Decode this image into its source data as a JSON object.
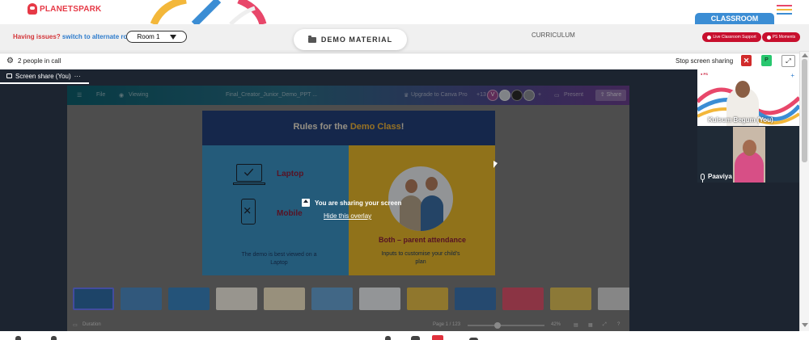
{
  "header": {
    "logo_text": "PLANETSPARK",
    "classroom_tab": "CLASSROOM"
  },
  "toolbar": {
    "issue_text": "Having issues?",
    "issue_link": "switch to alternate room",
    "room_value": "Room 1",
    "demo_material": "DEMO MATERIAL",
    "curriculum": "CURRICULUM",
    "live_classroom_support": "Live Classroom Support",
    "ps_moments": "PS Moments"
  },
  "call": {
    "people_count": "2 people in call",
    "stop_sharing": "Stop screen sharing",
    "stop_x": "✕",
    "self_avatar": "P"
  },
  "stage": {
    "tab_label": "Screen share (You)",
    "tab_menu": "···",
    "overlay_message": "You are sharing your screen",
    "hide_overlay": "Hide this overlay"
  },
  "shared_screen": {
    "menu_file": "File",
    "menu_viewing": "Viewing",
    "doc_name": "Final_Creator_Junior_Demo_PPT ...",
    "upgrade": "Upgrade to Canva Pro",
    "collab_count": "+13",
    "collab_initial": "V",
    "present": "Present",
    "share": "Share",
    "slide": {
      "title_prefix": "Rules for the ",
      "title_highlight": "Demo Class",
      "title_suffix": "!",
      "laptop_label": "Laptop",
      "mobile_label": "Mobile",
      "left_note": "The demo is best viewed on a Laptop",
      "right_heading": "Both – parent attendance",
      "right_note": "Inputs to customise your child's plan"
    },
    "duration": "Duration",
    "page_indicator": "Page 1 / 123",
    "zoom": "42%"
  },
  "participants": [
    {
      "name": "Kulsum Begum (You)"
    },
    {
      "name": "Paaviya"
    }
  ],
  "colors": {
    "brand_red": "#c8102e",
    "accent_blue": "#3b8dd4",
    "stage_bg": "#1c2430"
  }
}
